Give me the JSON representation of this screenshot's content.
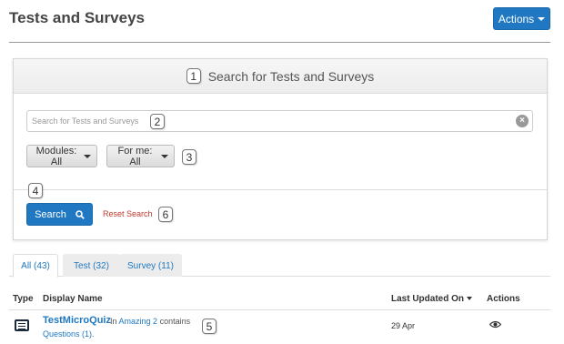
{
  "header": {
    "title": "Tests and Surveys",
    "actions_label": "Actions"
  },
  "search_panel": {
    "title": "Search for Tests and Surveys",
    "placeholder": "Search for Tests and Surveys",
    "value": "",
    "modules_label": "Modules: All",
    "for_me_label": "For me: All",
    "search_label": "Search",
    "reset_label": "Reset Search"
  },
  "annotations": {
    "b1": "1",
    "b2": "2",
    "b3": "3",
    "b4": "4",
    "b5": "5",
    "b6": "6"
  },
  "tabs": [
    {
      "label": "All (43)",
      "active": true
    },
    {
      "label": "Test (32)",
      "active": false
    },
    {
      "label": "Survey (11)",
      "active": false
    }
  ],
  "table": {
    "headers": {
      "type": "Type",
      "display_name": "Display Name",
      "last_updated": "Last Updated On",
      "actions": "Actions"
    },
    "rows": [
      {
        "name": "TestMicroQuiz",
        "in_text": "In",
        "module": "Amazing 2",
        "contains_text": "contains",
        "questions": "Questions (1).",
        "date": "29 Apr"
      }
    ]
  },
  "icons": [
    "caret-down-icon",
    "clear-icon",
    "search-icon",
    "list-icon",
    "eye-icon"
  ],
  "colors": {
    "primary": "#1f78c1",
    "reset_link": "#c0392b"
  }
}
